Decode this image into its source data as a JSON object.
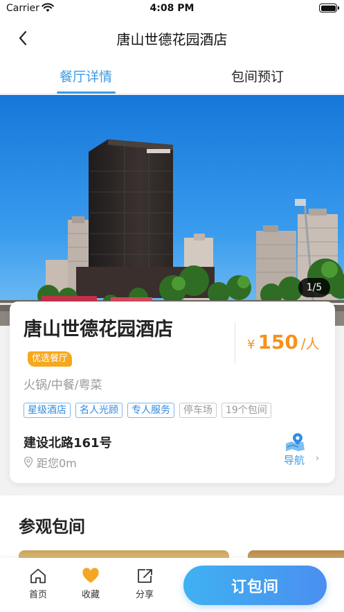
{
  "status_bar": {
    "carrier": "Carrier",
    "time": "4:08 PM"
  },
  "navbar": {
    "title": "唐山世德花园酒店",
    "back_icon": "chevron-left-icon"
  },
  "tabs": [
    {
      "label": "餐厅详情",
      "active": true
    },
    {
      "label": "包间预订",
      "active": false
    }
  ],
  "gallery": {
    "page_indicator": "1/5",
    "current": 1,
    "total": 5
  },
  "restaurant": {
    "name": "唐山世德花园酒店",
    "badge": "优选餐厅",
    "price_currency": "¥",
    "price_value": "150",
    "price_unit": "/人",
    "cuisine": "火锅/中餐/粤菜",
    "tags_highlight": [
      "星级酒店",
      "名人光顾",
      "专人服务"
    ],
    "tags_plain": [
      "停车场",
      "19个包间"
    ],
    "address": "建设北路161号",
    "distance": "距您0m",
    "nav_label": "导航",
    "nav_chevron": "›"
  },
  "section": {
    "title": "参观包间"
  },
  "bottom_bar": {
    "home_label": "首页",
    "favorite_label": "收藏",
    "share_label": "分享",
    "book_label": "订包间"
  },
  "colors": {
    "accent": "#3b9be6",
    "price": "#f5921e",
    "badge": "#f6a81e",
    "favorite_heart": "#f5a623"
  }
}
